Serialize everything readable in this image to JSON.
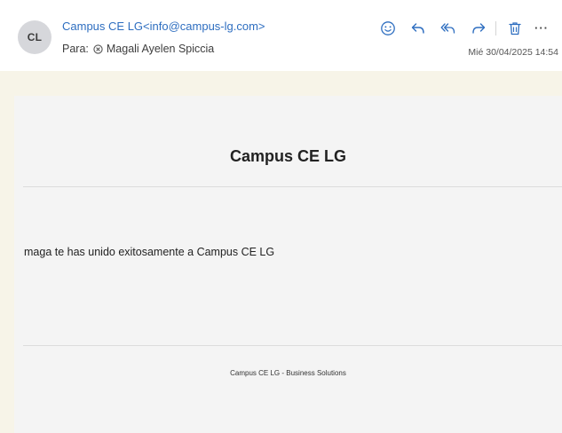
{
  "message": {
    "avatar_initials": "CL",
    "sender": "Campus CE LG<info@campus-lg.com>",
    "to_label": "Para:",
    "recipient": "Magali Ayelen Spiccia",
    "date": "Mié 30/04/2025 14:54"
  },
  "toolbar": {
    "icons": [
      "smiley-icon",
      "reply-icon",
      "reply-all-icon",
      "forward-icon",
      "trash-icon",
      "more-icon"
    ],
    "more_label": "···",
    "accent_color": "#2e6ec0"
  },
  "email": {
    "title": "Campus CE LG",
    "body": "maga te has unido exitosamente a Campus CE LG",
    "footer": "Campus CE LG - Business Solutions"
  }
}
